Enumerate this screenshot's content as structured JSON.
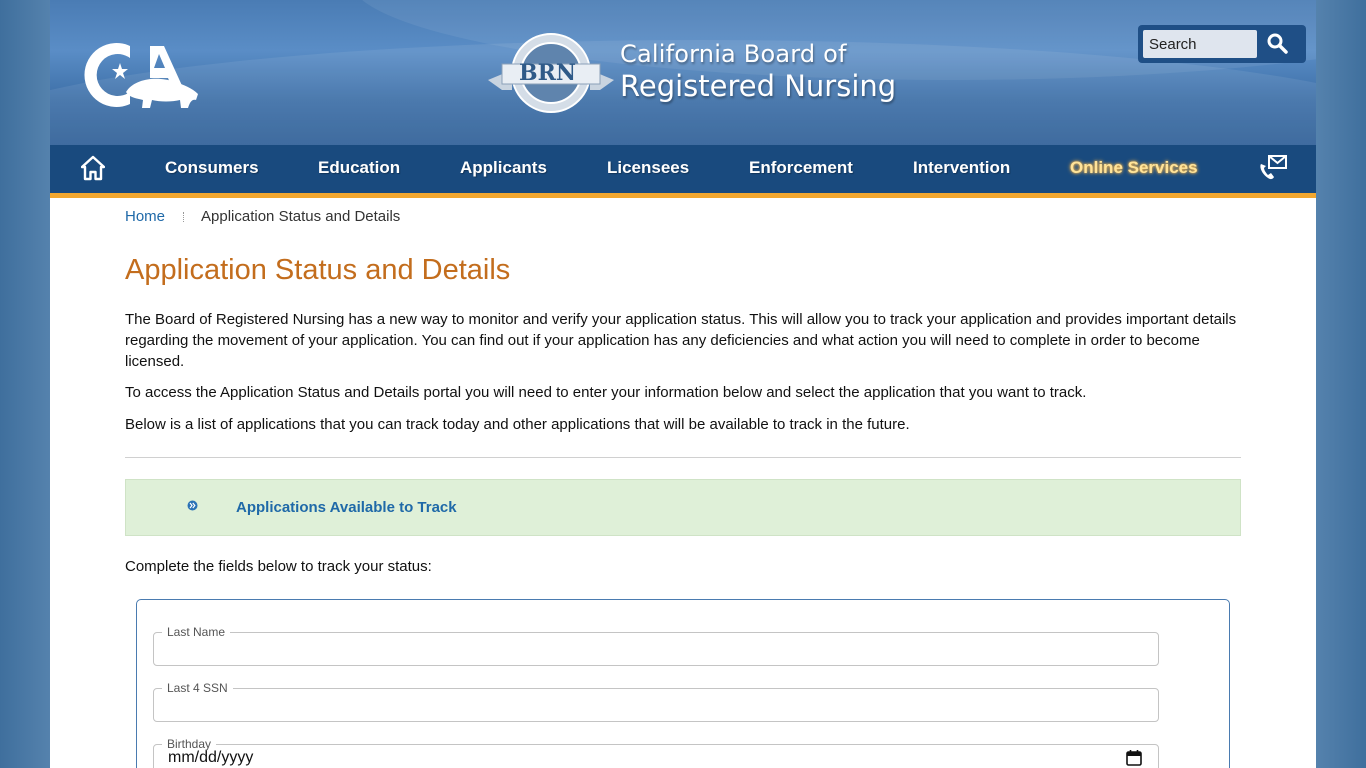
{
  "header": {
    "brand_line1": "California Board of",
    "brand_line2": "Registered Nursing",
    "seal_text": "BRN",
    "search_placeholder": "Search"
  },
  "nav": {
    "items": [
      {
        "label": "Consumers"
      },
      {
        "label": "Education"
      },
      {
        "label": "Applicants"
      },
      {
        "label": "Licensees"
      },
      {
        "label": "Enforcement"
      },
      {
        "label": "Intervention"
      },
      {
        "label": "Online Services"
      }
    ]
  },
  "breadcrumb": {
    "home": "Home",
    "current": "Application Status and Details"
  },
  "main": {
    "title": "Application Status and Details",
    "para1": "The Board of Registered Nursing has a new way to monitor and verify your application status. This will allow you to track your application and provides important details regarding the movement of your application. You can find out if your application has any deficiencies and what action you will need to complete in order to become licensed.",
    "para2": "To access the Application Status and Details portal you will need to enter your information below and select the application that you want to track.",
    "para3": "Below is a list of applications that you can track today and other applications that will be available to track in the future.",
    "accordion_label": "Applications Available to Track",
    "form_intro": "Complete the fields below to track your status:"
  },
  "form": {
    "last_name_label": "Last Name",
    "last_name_value": "",
    "ssn_label": "Last 4 SSN",
    "ssn_value": "",
    "birthday_label": "Birthday",
    "birthday_placeholder": "mm/dd/yyyy"
  },
  "colors": {
    "nav_bg": "#194a7e",
    "nav_accent": "#f2a72f",
    "title": "#c36d1d",
    "link": "#1f69a8",
    "accordion_bg": "#dff0d8"
  }
}
